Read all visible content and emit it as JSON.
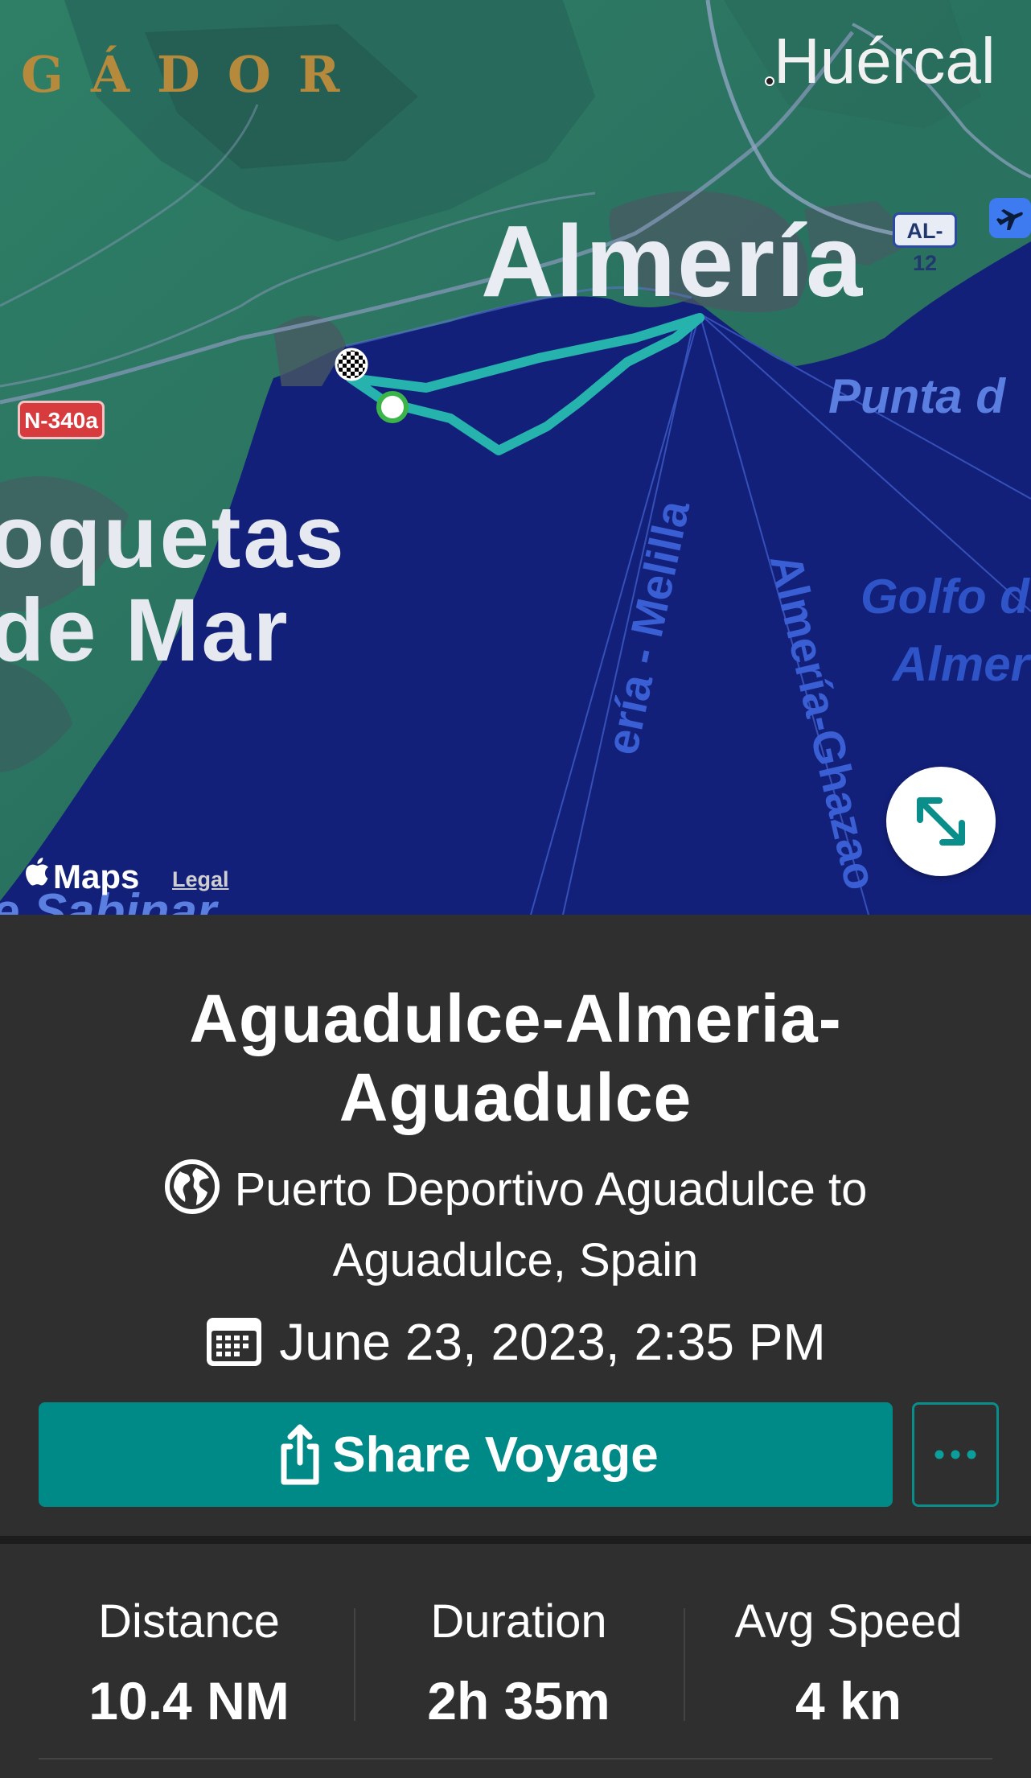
{
  "map": {
    "labels": {
      "gador": "GÁDOR",
      "huercal": "Huércal",
      "almeria": "Almería",
      "roquetas_line1": "oquetas",
      "roquetas_line2": "de Mar",
      "punta": "Punta d",
      "golfo_line1": "Golfo d",
      "golfo_line2": "Almer",
      "ferry_route_1": "ería - Melilla",
      "ferry_route_2": "Almería-Ghazao",
      "sabinar": "e Sabinar"
    },
    "road_badges": {
      "n340a": "N-340a",
      "al12": "AL-12"
    },
    "attribution": "Maps",
    "legal": "Legal",
    "route_color": "#27b3ad",
    "sea_color": "#13207a",
    "land_color": "#2d7a6a",
    "icons": {
      "start_marker": "start-point-icon",
      "finish_marker": "checkered-flag-icon",
      "airport": "airport-icon",
      "expand": "expand-icon"
    }
  },
  "voyage": {
    "title": "Aguadulce-Almeria-Aguadulce",
    "location": "Puerto Deportivo Aguadulce to Aguadulce, Spain",
    "date": "June 23, 2023, 2:35 PM",
    "share_label": "Share Voyage",
    "accent_color": "#008a87"
  },
  "stats": [
    {
      "label": "Distance",
      "value": "10.4 NM"
    },
    {
      "label": "Duration",
      "value": "2h 35m"
    },
    {
      "label": "Avg Speed",
      "value": "4 kn"
    }
  ]
}
